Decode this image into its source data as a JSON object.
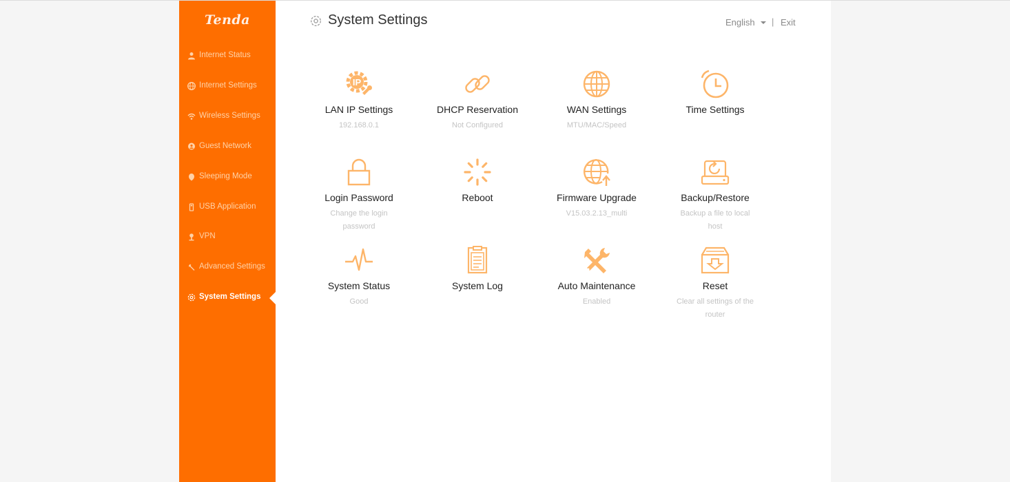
{
  "brand": {
    "logo_text": "Tenda",
    "accent_color": "#fe6e00",
    "icon_color": "#fdb569"
  },
  "sidebar": {
    "items": [
      {
        "label": "Internet Status",
        "icon": "person-icon"
      },
      {
        "label": "Internet Settings",
        "icon": "globe-icon"
      },
      {
        "label": "Wireless Settings",
        "icon": "wifi-icon"
      },
      {
        "label": "Guest Network",
        "icon": "guest-icon"
      },
      {
        "label": "Sleeping Mode",
        "icon": "moon-icon"
      },
      {
        "label": "USB Application",
        "icon": "usb-icon"
      },
      {
        "label": "VPN",
        "icon": "vpn-icon"
      },
      {
        "label": "Advanced Settings",
        "icon": "wrench-icon"
      },
      {
        "label": "System Settings",
        "icon": "gear-icon",
        "active": true
      }
    ]
  },
  "header": {
    "title": "System Settings",
    "language": "English",
    "separator": "|",
    "exit": "Exit"
  },
  "tiles": [
    {
      "name": "LAN IP Settings",
      "desc": "192.168.0.1",
      "icon": "lan-ip-gear-icon"
    },
    {
      "name": "DHCP Reservation",
      "desc": "Not Configured",
      "icon": "link-icon"
    },
    {
      "name": "WAN Settings",
      "desc": "MTU/MAC/Speed",
      "icon": "globe-icon"
    },
    {
      "name": "Time Settings",
      "desc": "",
      "icon": "clock-icon"
    },
    {
      "name": "Login Password",
      "desc": "Change the login password",
      "icon": "lock-icon"
    },
    {
      "name": "Reboot",
      "desc": "",
      "icon": "spinner-icon"
    },
    {
      "name": "Firmware Upgrade",
      "desc": "V15.03.2.13_multi",
      "icon": "globe-upload-icon"
    },
    {
      "name": "Backup/Restore",
      "desc": "Backup a file to local host",
      "icon": "backup-drive-icon"
    },
    {
      "name": "System Status",
      "desc": "Good",
      "icon": "pulse-icon"
    },
    {
      "name": "System Log",
      "desc": "",
      "icon": "clipboard-icon"
    },
    {
      "name": "Auto Maintenance",
      "desc": "Enabled",
      "icon": "tools-icon"
    },
    {
      "name": "Reset",
      "desc": "Clear all settings of the router",
      "icon": "reset-box-icon"
    }
  ]
}
